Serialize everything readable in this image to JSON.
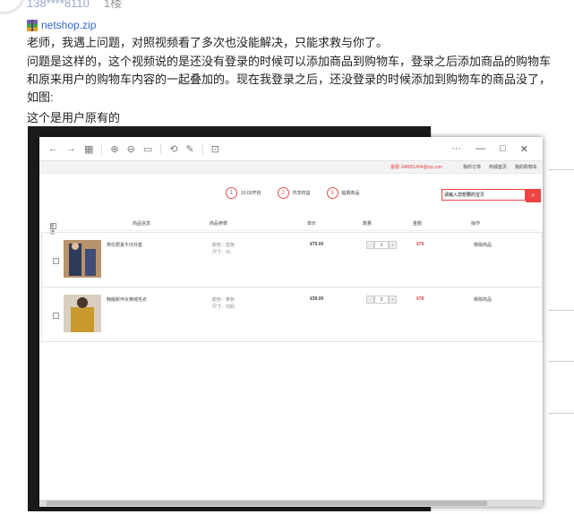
{
  "post": {
    "user": "138****8110",
    "floor": "1楼",
    "attachment": "netshop.zip",
    "paragraph1": "老师，我遇上问题，对照视频看了多次也没能解决，只能求救与你了。",
    "paragraph2": "问题是这样的，这个视频说的是还没有登录的时候可以添加商品到购物车，登录之后添加商品的购物车和原来用户的购物车内容的一起叠加的。现在我登录之后，还没登录的时候添加到购物车的商品没了，如图:",
    "paragraph3": "这个是用户原有的"
  },
  "browser": {
    "toolbar_more": "···",
    "min": "—",
    "max": "□",
    "close": "✕"
  },
  "shop": {
    "hotline": "客服 348051494@qq.com",
    "links": [
      "我的订单",
      "商城首页",
      "我的购物车"
    ],
    "steps": [
      {
        "num": "1",
        "label": "10:00开抢"
      },
      {
        "num": "2",
        "label": "共享权益"
      },
      {
        "num": "3",
        "label": "临期商品"
      }
    ],
    "search_value": "请输入您想要的宝贝",
    "search_icon": "search-icon",
    "headers": {
      "select_all": "全选",
      "info": "商品信息",
      "spec": "商品参数",
      "price": "单价",
      "qty": "数量",
      "total": "金额",
      "op": "操作"
    },
    "items": [
      {
        "name": "男伦居夏牛仔外套",
        "spec1": "颜色：蓝色",
        "spec2": "尺寸：XL",
        "price": "¥79.00",
        "qty": "1",
        "total": "¥79",
        "op": "移除商品"
      },
      {
        "name": "韩版新伴女黄绒毛衣",
        "spec1": "颜色：黄色",
        "spec2": "尺寸：均码",
        "price": "¥39.00",
        "qty": "2",
        "total": "¥78",
        "op": "移除商品"
      }
    ]
  },
  "colors": {
    "accent": "#e04444",
    "link": "#3366cc"
  }
}
